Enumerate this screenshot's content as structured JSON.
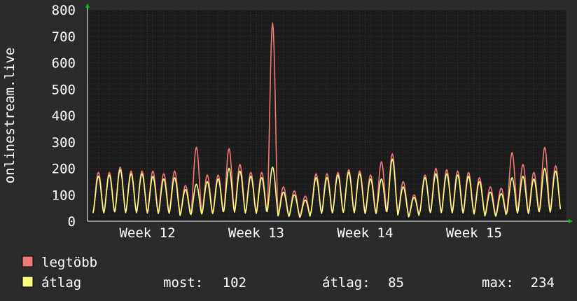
{
  "colors": {
    "background": "#2b2b2b",
    "plot_bg": "#1c1c1c",
    "grid_minor": "#3a3a3a",
    "grid_major": "#5a2a2a",
    "axis": "#ffffff",
    "arrow": "#00cc00",
    "max_series": "#f07878",
    "avg_series": "#ffff80"
  },
  "chart_data": {
    "type": "line",
    "ylabel": "onlinestream.live",
    "ylim": [
      0,
      800
    ],
    "y_ticks": [
      0,
      100,
      200,
      300,
      400,
      500,
      600,
      700,
      800
    ],
    "x_range_days": [
      0,
      44
    ],
    "x_ticks": [
      {
        "label": "Week 12",
        "day": 5.5
      },
      {
        "label": "Week 13",
        "day": 15.5
      },
      {
        "label": "Week 14",
        "day": 25.5
      },
      {
        "label": "Week 15",
        "day": 35.5
      }
    ],
    "grid": true,
    "series": [
      {
        "name": "legtöbb",
        "color": "#f07878",
        "daily_peaks": [
          185,
          185,
          205,
          190,
          190,
          190,
          180,
          190,
          135,
          280,
          175,
          175,
          275,
          215,
          185,
          185,
          750,
          130,
          115,
          95,
          180,
          180,
          185,
          195,
          190,
          175,
          225,
          255,
          150,
          100,
          175,
          200,
          195,
          190,
          185,
          165,
          130,
          125,
          260,
          215,
          185,
          280,
          210
        ]
      },
      {
        "name": "átlag",
        "color": "#ffff80",
        "daily_peaks": [
          170,
          175,
          195,
          180,
          180,
          170,
          160,
          165,
          120,
          140,
          150,
          160,
          200,
          190,
          170,
          165,
          205,
          110,
          100,
          80,
          165,
          165,
          175,
          185,
          180,
          160,
          160,
          235,
          130,
          90,
          165,
          180,
          180,
          175,
          170,
          150,
          110,
          105,
          165,
          170,
          160,
          200,
          190
        ]
      }
    ],
    "legend": {
      "items": [
        {
          "label": "legtöbb",
          "color": "#f07878"
        },
        {
          "label": "átlag",
          "color": "#ffff80"
        }
      ],
      "stats": [
        {
          "label": "most:",
          "value": "102"
        },
        {
          "label": "átlag:",
          "value": "85"
        },
        {
          "label": "max:",
          "value": "234"
        }
      ]
    }
  }
}
